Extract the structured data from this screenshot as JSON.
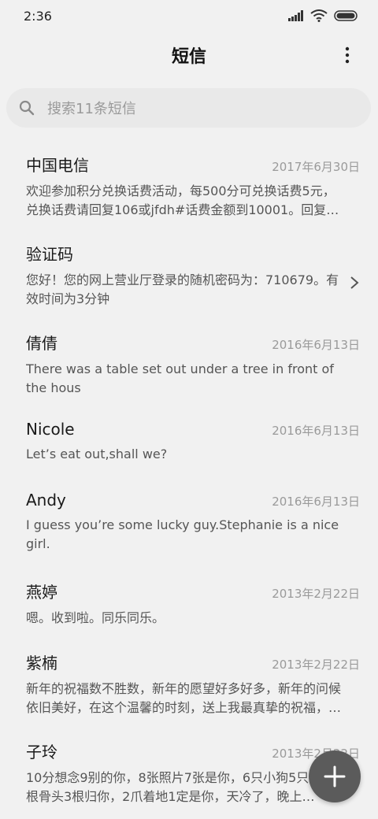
{
  "status_bar": {
    "time": "2:36"
  },
  "header": {
    "title": "短信"
  },
  "search": {
    "placeholder": "搜索11条短信"
  },
  "conversations": [
    {
      "name": "中国电信",
      "date": "2017年6月30日",
      "preview": "欢迎参加积分兑换话费活动，每500分可兑换话费5元，兑换话费请回复106或jfdh#话费金额到10001。回复…"
    },
    {
      "name": "验证码",
      "date": "",
      "preview": "您好！您的网上营业厅登录的随机密码为：710679。有效时间为3分钟"
    },
    {
      "name": "倩倩",
      "date": "2016年6月13日",
      "preview": "There was a table set out under a tree in front of the hous"
    },
    {
      "name": "Nicole",
      "date": "2016年6月13日",
      "preview": "Let’s eat out,shall we?"
    },
    {
      "name": "Andy",
      "date": "2016年6月13日",
      "preview": "I guess you’re some lucky guy.Stephanie is a nice girl."
    },
    {
      "name": "燕婷",
      "date": "2013年2月22日",
      "preview": "嗯。收到啦。同乐同乐。"
    },
    {
      "name": "紫楠",
      "date": "2013年2月22日",
      "preview": "新年的祝福数不胜数，新年的愿望好多好多，新年的问候依旧美好，在这个温馨的时刻，送上我最真挚的祝福，…"
    },
    {
      "name": "子玲",
      "date": "2013年2月22日",
      "preview": "10分想念9别的你，8张照片7张是你，6只小狗5只，4根骨头3根归你，2爪着地1定是你，天冷了，晚上…"
    }
  ],
  "colors": {
    "background": "#f1f1f1",
    "search_bg": "#e9e9e9",
    "fab": "#5b5b5b"
  },
  "icons": {
    "search": "search-icon",
    "more": "more-vertical-icon",
    "chevron": "chevron-right-icon",
    "fab": "plus-icon"
  }
}
